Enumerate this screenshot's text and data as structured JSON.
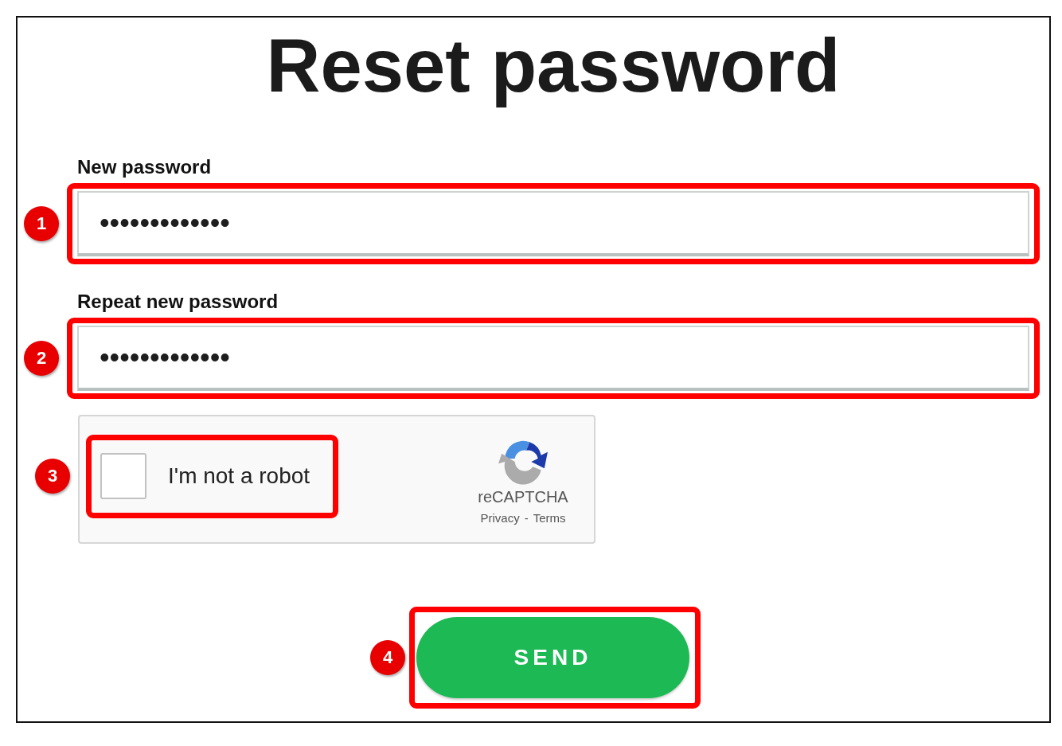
{
  "title": "Reset password",
  "fields": [
    {
      "label": "New password",
      "value": "•••••••••••••",
      "marker": "1"
    },
    {
      "label": "Repeat new password",
      "value": "•••••••••••••",
      "marker": "2"
    }
  ],
  "captcha": {
    "label": "I'm not a robot",
    "checked": false,
    "marker": "3",
    "brand": "reCAPTCHA",
    "links": [
      "Privacy",
      "Terms"
    ],
    "separator": "-"
  },
  "button": {
    "label": "SEND",
    "marker": "4"
  }
}
